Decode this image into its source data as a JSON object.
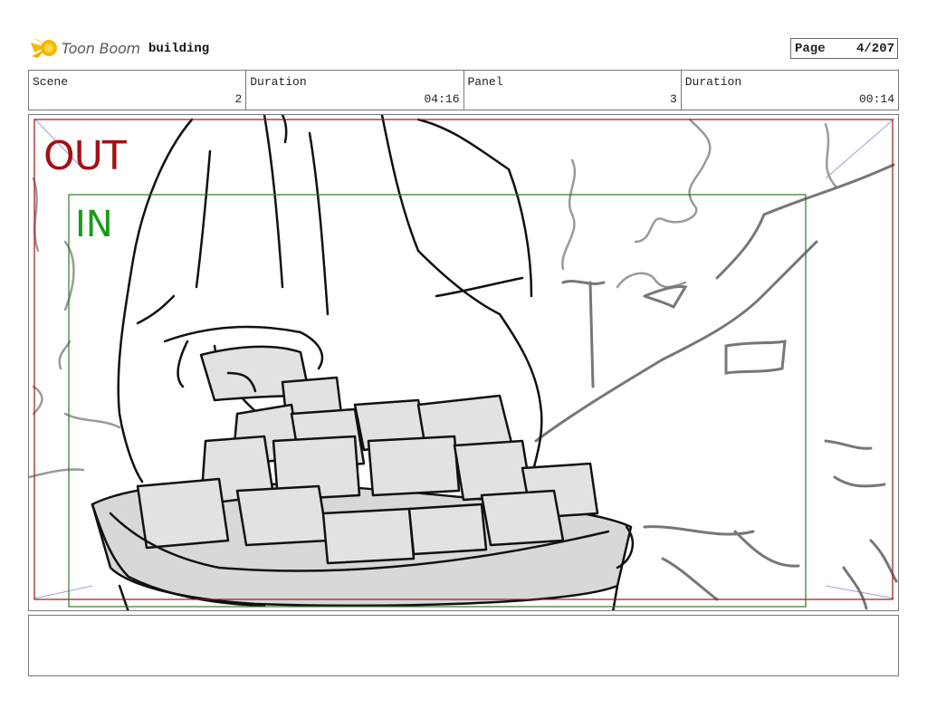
{
  "header": {
    "logo_text": "Toon Boom",
    "project_name": "building",
    "page_label": "Page",
    "page_value": "4/207"
  },
  "info": {
    "scene_label": "Scene",
    "scene_value": "2",
    "scene_duration_label": "Duration",
    "scene_duration_value": "04:16",
    "panel_label": "Panel",
    "panel_value": "3",
    "panel_duration_label": "Duration",
    "panel_duration_value": "00:14"
  },
  "frame": {
    "out_label": "OUT",
    "in_label": "IN",
    "out_color": "#a50f14",
    "in_color": "#1a9a1a"
  },
  "notes": {
    "text": ""
  }
}
